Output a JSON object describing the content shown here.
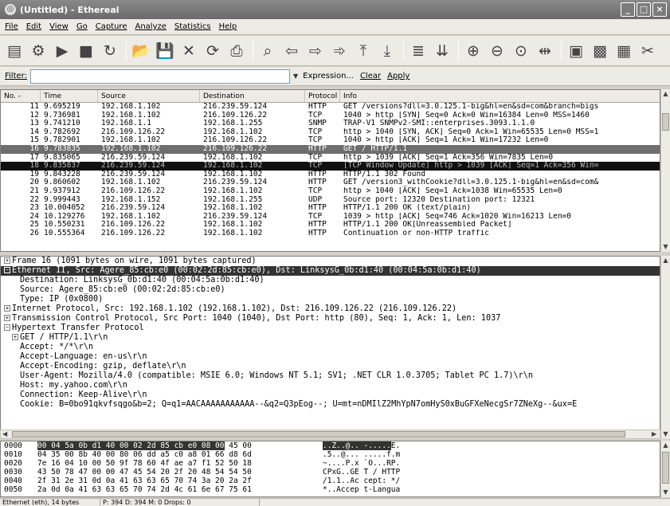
{
  "window": {
    "title": "(Untitled) - Ethereal"
  },
  "menu": [
    "File",
    "Edit",
    "View",
    "Go",
    "Capture",
    "Analyze",
    "Statistics",
    "Help"
  ],
  "toolbar": {
    "groups": [
      [
        "list-interfaces-icon",
        "capture-options-icon",
        "start-capture-icon",
        "stop-capture-icon",
        "restart-capture-icon"
      ],
      [
        "open-file-icon",
        "save-file-icon",
        "close-file-icon",
        "reload-icon",
        "print-icon"
      ],
      [
        "find-packet-icon",
        "go-back-icon",
        "go-forward-icon",
        "go-to-packet-icon",
        "go-first-icon",
        "go-last-icon"
      ],
      [
        "colorize-icon",
        "auto-scroll-icon"
      ],
      [
        "zoom-in-icon",
        "zoom-out-icon",
        "zoom-normal-icon",
        "resize-columns-icon"
      ],
      [
        "capture-filters-icon",
        "display-filters-icon",
        "coloring-rules-icon",
        "preferences-icon"
      ]
    ]
  },
  "filter": {
    "label": "Filter:",
    "value": "",
    "expression_label": "Expression...",
    "clear_label": "Clear",
    "apply_label": "Apply"
  },
  "packet_list": {
    "columns": [
      "No. -",
      "Time",
      "Source",
      "Destination",
      "Protocol",
      "Info"
    ],
    "rows": [
      {
        "no": "11",
        "time": "9.695219",
        "src": "192.168.1.102",
        "dst": "216.239.59.124",
        "proto": "HTTP",
        "info": "GET /versions?dll=3.0.125.1-big&hl=en&sd=com&branch=bigs",
        "style": "normal"
      },
      {
        "no": "12",
        "time": "9.736981",
        "src": "192.168.1.102",
        "dst": "216.109.126.22",
        "proto": "TCP",
        "info": "1040 > http [SYN] Seq=0 Ack=0 Win=16384 Len=0 MSS=1460",
        "style": "normal"
      },
      {
        "no": "13",
        "time": "9.741210",
        "src": "192.168.1.1",
        "dst": "192.168.1.255",
        "proto": "SNMP",
        "info": "TRAP-V1 SNMPv2-SMI::enterprises.3093.1.1.0",
        "style": "normal"
      },
      {
        "no": "14",
        "time": "9.782692",
        "src": "216.109.126.22",
        "dst": "192.168.1.102",
        "proto": "TCP",
        "info": "http > 1040 [SYN, ACK] Seq=0 Ack=1 Win=65535 Len=0 MSS=1",
        "style": "normal"
      },
      {
        "no": "15",
        "time": "9.782901",
        "src": "192.168.1.102",
        "dst": "216.109.126.22",
        "proto": "TCP",
        "info": "1040 > http [ACK] Seq=1 Ack=1 Win=17232 Len=0",
        "style": "normal"
      },
      {
        "no": "16",
        "time": "9.783835",
        "src": "192.168.1.102",
        "dst": "216.109.126.22",
        "proto": "HTTP",
        "info": "GET / HTTP/1.1",
        "style": "selected"
      },
      {
        "no": "17",
        "time": "9.835065",
        "src": "216.239.59.124",
        "dst": "192.168.1.102",
        "proto": "TCP",
        "info": "http > 1039 [ACK] Seq=1 Ack=356 Win=7835 Len=0",
        "style": "normal"
      },
      {
        "no": "18",
        "time": "9.835837",
        "src": "216.239.59.124",
        "dst": "192.168.1.102",
        "proto": "TCP",
        "info": "[TCP Window Update] http > 1039 [ACK] Seq=1 Ack=356 Win=",
        "style": "black"
      },
      {
        "no": "19",
        "time": "9.843228",
        "src": "216.239.59.124",
        "dst": "192.168.1.102",
        "proto": "HTTP",
        "info": "HTTP/1.1 302 Found",
        "style": "normal"
      },
      {
        "no": "20",
        "time": "9.860602",
        "src": "192.168.1.102",
        "dst": "216.239.59.124",
        "proto": "HTTP",
        "info": "GET /version3_withCookie?dll=3.0.125.1-big&hl=en&sd=com&",
        "style": "normal"
      },
      {
        "no": "21",
        "time": "9.937912",
        "src": "216.109.126.22",
        "dst": "192.168.1.102",
        "proto": "TCP",
        "info": "http > 1040 [ACK] Seq=1 Ack=1038 Win=65535 Len=0",
        "style": "normal"
      },
      {
        "no": "22",
        "time": "9.999443",
        "src": "192.168.1.152",
        "dst": "192.168.1.255",
        "proto": "UDP",
        "info": "Source port: 12320  Destination port: 12321",
        "style": "normal"
      },
      {
        "no": "23",
        "time": "10.004052",
        "src": "216.239.59.124",
        "dst": "192.168.1.102",
        "proto": "HTTP",
        "info": "HTTP/1.1 200 OK (text/plain)",
        "style": "normal"
      },
      {
        "no": "24",
        "time": "10.129276",
        "src": "192.168.1.102",
        "dst": "216.239.59.124",
        "proto": "TCP",
        "info": "1039 > http [ACK] Seq=746 Ack=1020 Win=16213 Len=0",
        "style": "normal"
      },
      {
        "no": "25",
        "time": "10.550231",
        "src": "216.109.126.22",
        "dst": "192.168.1.102",
        "proto": "HTTP",
        "info": "HTTP/1.1 200 OK[Unreassembled Packet]",
        "style": "normal"
      },
      {
        "no": "26",
        "time": "10.555364",
        "src": "216.109.126.22",
        "dst": "192.168.1.102",
        "proto": "HTTP",
        "info": "Continuation or non-HTTP traffic",
        "style": "normal"
      }
    ]
  },
  "details": [
    {
      "text": "Frame 16 (1091 bytes on wire, 1091 bytes captured)",
      "indent": 0,
      "exp": "+",
      "sel": false
    },
    {
      "text": "Ethernet II, Src: Agere_85:cb:e0 (00:02:2d:85:cb:e0), Dst: LinksysG_0b:d1:40 (00:04:5a:0b:d1:40)",
      "indent": 0,
      "exp": "-",
      "sel": true
    },
    {
      "text": "Destination: LinksysG_0b:d1:40 (00:04:5a:0b:d1:40)",
      "indent": 2,
      "exp": "",
      "sel": false
    },
    {
      "text": "Source: Agere_85:cb:e0 (00:02:2d:85:cb:e0)",
      "indent": 2,
      "exp": "",
      "sel": false
    },
    {
      "text": "Type: IP (0x0800)",
      "indent": 2,
      "exp": "",
      "sel": false
    },
    {
      "text": "Internet Protocol, Src: 192.168.1.102 (192.168.1.102), Dst: 216.109.126.22 (216.109.126.22)",
      "indent": 0,
      "exp": "+",
      "sel": false
    },
    {
      "text": "Transmission Control Protocol, Src Port: 1040 (1040), Dst Port: http (80), Seq: 1, Ack: 1, Len: 1037",
      "indent": 0,
      "exp": "+",
      "sel": false
    },
    {
      "text": "Hypertext Transfer Protocol",
      "indent": 0,
      "exp": "-",
      "sel": false
    },
    {
      "text": "GET / HTTP/1.1\\r\\n",
      "indent": 1,
      "exp": "+",
      "sel": false
    },
    {
      "text": "Accept: */*\\r\\n",
      "indent": 2,
      "exp": "",
      "sel": false
    },
    {
      "text": "Accept-Language: en-us\\r\\n",
      "indent": 2,
      "exp": "",
      "sel": false
    },
    {
      "text": "Accept-Encoding: gzip, deflate\\r\\n",
      "indent": 2,
      "exp": "",
      "sel": false
    },
    {
      "text": "User-Agent: Mozilla/4.0 (compatible: MSIE 6.0; Windows NT 5.1; SV1; .NET CLR 1.0.3705; Tablet PC 1.7)\\r\\n",
      "indent": 2,
      "exp": "",
      "sel": false
    },
    {
      "text": "Host: my.yahoo.com\\r\\n",
      "indent": 2,
      "exp": "",
      "sel": false
    },
    {
      "text": "Connection: Keep-Alive\\r\\n",
      "indent": 2,
      "exp": "",
      "sel": false
    },
    {
      "text": "Cookie: B=0bo91qkvfsqgo&b=2; Q=q1=AACAAAAAAAAAAA--&q2=Q3pEog--; U=mt=nDMIlZ2MhYpN7omHyS0xBuGFXeNecgSr7ZNeXg--&ux=E",
      "indent": 2,
      "exp": "",
      "sel": false
    }
  ],
  "bytes": [
    {
      "off": "0000",
      "hex_hl": "00 04 5a 0b d1 40 00 02  2d 85 cb e0 08 00",
      "hex_rest": " 45 00",
      "asc_hl": "..Z..@.. -.....",
      "asc_rest": "E."
    },
    {
      "off": "0010",
      "hex_hl": "",
      "hex_rest": "04 35 00 8b 40 00 80 06  dd a5 c0 a8 01 66 d8 6d",
      "asc_hl": "",
      "asc_rest": ".5..@... .....f.m"
    },
    {
      "off": "0020",
      "hex_hl": "",
      "hex_rest": "7e 16 04 10 00 50 9f 78  60 4f ae a7 f1 52 50 18",
      "asc_hl": "",
      "asc_rest": "~....P.x `O...RP."
    },
    {
      "off": "0030",
      "hex_hl": "",
      "hex_rest": "43 50 78 47 00 00 47 45  54 20 2f 20 48 54 54 50",
      "asc_hl": "",
      "asc_rest": "CPxG..GE T / HTTP"
    },
    {
      "off": "0040",
      "hex_hl": "",
      "hex_rest": "2f 31 2e 31 0d 0a 41 63  63 65 70 74 3a 20 2a 2f",
      "asc_hl": "",
      "asc_rest": "/1.1..Ac cept: */"
    },
    {
      "off": "0050",
      "hex_hl": "",
      "hex_rest": "2a 0d 0a 41 63 63 65 70  74 2d 4c 61 6e 67 75 61",
      "asc_hl": "",
      "asc_rest": "*..Accep t-Langua"
    }
  ],
  "status": {
    "left": "Ethernet (eth), 14 bytes",
    "right": "P: 394 D: 394 M: 0 Drops: 0"
  },
  "colors": {
    "selected_row_bg": "#6e6e6e",
    "black_row_bg": "#111111",
    "highlight_bg": "#333333"
  }
}
